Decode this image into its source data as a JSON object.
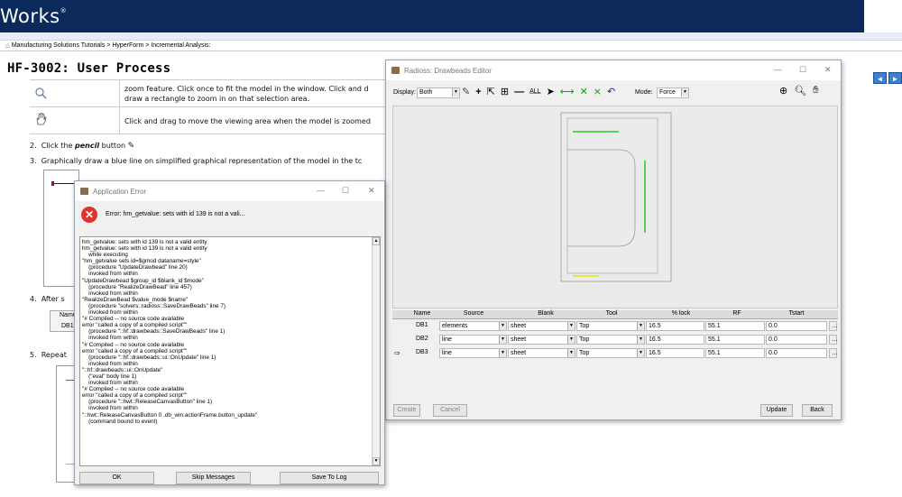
{
  "banner": {
    "logo": "Works",
    "logo_mark": "®"
  },
  "breadcrumb": {
    "home_icon": "home-icon",
    "text": "Manufacturing Solutions Tutorials > HyperForm > Incremental Analysis:"
  },
  "page": {
    "title": "HF-3002: User Process"
  },
  "nav": {
    "prev": "◄",
    "next": "►"
  },
  "doc": {
    "row1_text_a": "zoom feature. Click once to fit the model in the window. Click and d",
    "row1_text_b": "draw a rectangle to zoom in on that selection area.",
    "row2_text": "Click and drag to move the viewing area when the model is zoomed",
    "step2_num": "2.",
    "step2_a": "Click the",
    "step2_b": "pencil",
    "step2_c": "button",
    "step3_num": "3.",
    "step3_text": "Graphically draw a blue line on simplified graphical representation of the model in the tc",
    "step4_num": "4.",
    "step4_text": "After s",
    "step4_table_head": "Name",
    "step4_table_cell": "DB1",
    "step5_num": "5.",
    "step5_text": "Repeat"
  },
  "error_dialog": {
    "title": "Application Error",
    "message": "Error: hm_getvalue: sets with id 139 is not a vali...",
    "trace": [
      "hm_getvalue: sets with id 139 is not a valid entity",
      "hm_getvalue: sets with id 139 is not a valid entity",
      "    while executing",
      "\"hm_getvalue sets id=$gmod dataname=style\"",
      "    (procedure \"UpdateDrawbead\" line 20)",
      "    invoked from within",
      "\"UpdateDrawbead $group_id $blank_id $mode\"",
      "    (procedure \"RealizeDrawBead\" line 457)",
      "    invoked from within",
      "\"RealizeDrawBead $value_mode $name\"",
      "    (procedure \"solvers::radioss::SaveDrawBeads\" line 7)",
      "    invoked from within",
      "\"# Compiled -- no source code available",
      "error \"called a copy of a compiled script\"\"",
      "    (procedure \"::hf::drawbeads::SaveDrawBeads\" line 1)",
      "    invoked from within",
      "\"# Compiled -- no source code available",
      "error \"called a copy of a compiled script\"\"",
      "    (procedure \"::hf::drawbeads::ui::OnUpdate\" line 1)",
      "    invoked from within",
      "\"::hf::drawbeads::ui::OnUpdate\"",
      "    (\"eval\" body line 1)",
      "    invoked from within",
      "\"# Compiled -- no source code available",
      "error \"called a copy of a compiled script\"\"",
      "    (procedure \"::hwt::ReleaseCanvasButton\" line 1)",
      "    invoked from within",
      "\"::hwt::ReleaseCanvasButton 0 .db_win.actionFrame.button_update\"",
      "    (command bound to event)"
    ],
    "buttons": {
      "ok": "OK",
      "skip": "Skip Messages",
      "save": "Save To Log"
    }
  },
  "editor": {
    "title": "Radioss: Drawbeads Editor",
    "display_label": "Display:",
    "display_value": "Both",
    "mode_label": "Mode:",
    "mode_value": "Force",
    "columns": [
      "Name",
      "Source",
      "Blank",
      "Tool",
      "% lock",
      "RF",
      "Tstart"
    ],
    "rows": [
      {
        "name": "DB1",
        "source": "elements",
        "blank": "sheet",
        "tool": "Top",
        "lock": "16.5",
        "rf": "55.1",
        "tstart": "0.0",
        "current": false
      },
      {
        "name": "DB2",
        "source": "line",
        "blank": "sheet",
        "tool": "Top",
        "lock": "16.5",
        "rf": "55.1",
        "tstart": "0.0",
        "current": false
      },
      {
        "name": "DB3",
        "source": "line",
        "blank": "sheet",
        "tool": "Top",
        "lock": "16.5",
        "rf": "55.1",
        "tstart": "0.0",
        "current": true
      }
    ],
    "buttons": {
      "create": "Create",
      "cancel": "Cancel",
      "update": "Update",
      "back": "Back"
    },
    "colors": {
      "green": "#22cc22",
      "yellow": "#e6e600"
    }
  }
}
